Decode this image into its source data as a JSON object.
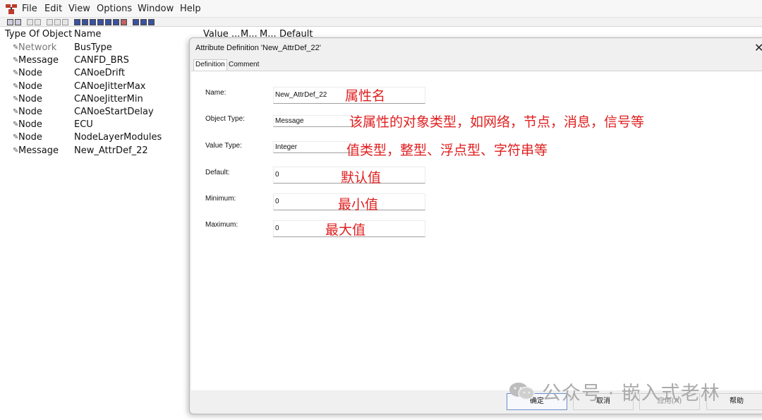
{
  "menubar": {
    "items": [
      "File",
      "Edit",
      "View",
      "Options",
      "Window",
      "Help"
    ]
  },
  "list": {
    "columns": [
      "Type Of Object",
      "Name",
      "Value ...",
      "M...",
      "M...",
      "Default"
    ],
    "rows": [
      {
        "type": "Network",
        "name": "BusType"
      },
      {
        "type": "Message",
        "name": "CANFD_BRS"
      },
      {
        "type": "Node",
        "name": "CANoeDrift"
      },
      {
        "type": "Node",
        "name": "CANoeJitterMax"
      },
      {
        "type": "Node",
        "name": "CANoeJitterMin"
      },
      {
        "type": "Node",
        "name": "CANoeStartDelay"
      },
      {
        "type": "Node",
        "name": "ECU"
      },
      {
        "type": "Node",
        "name": "NodeLayerModules"
      },
      {
        "type": "Message",
        "name": "New_AttrDef_22"
      }
    ]
  },
  "dialog": {
    "title": "Attribute Definition 'New_AttrDef_22'",
    "close_glyph": "✕",
    "tabs": [
      "Definition",
      "Comment"
    ],
    "fields": {
      "name": {
        "label": "Name:",
        "value": "New_AttrDef_22"
      },
      "object_type": {
        "label": "Object Type:",
        "value": "Message"
      },
      "value_type": {
        "label": "Value Type:",
        "value": "Integer"
      },
      "default": {
        "label": "Default:",
        "value": "0"
      },
      "minimum": {
        "label": "Minimum:",
        "value": "0"
      },
      "maximum": {
        "label": "Maximum:",
        "value": "0"
      }
    },
    "buttons": {
      "ok": "确定",
      "cancel": "取消",
      "apply": "应用(A)",
      "help": "帮助"
    }
  },
  "annotations": {
    "name": "属性名",
    "object_type": "该属性的对象类型，如网络，节点，消息，信号等",
    "value_type": "值类型，整型、浮点型、字符串等",
    "default": "默认值",
    "minimum": "最小值",
    "maximum": "最大值"
  },
  "watermark": {
    "text": "公众号 · 嵌入式老林"
  },
  "colors": {
    "annotation": "#e02020",
    "watermark": "#ababab",
    "dialog_bg": "#f0f0f0"
  }
}
